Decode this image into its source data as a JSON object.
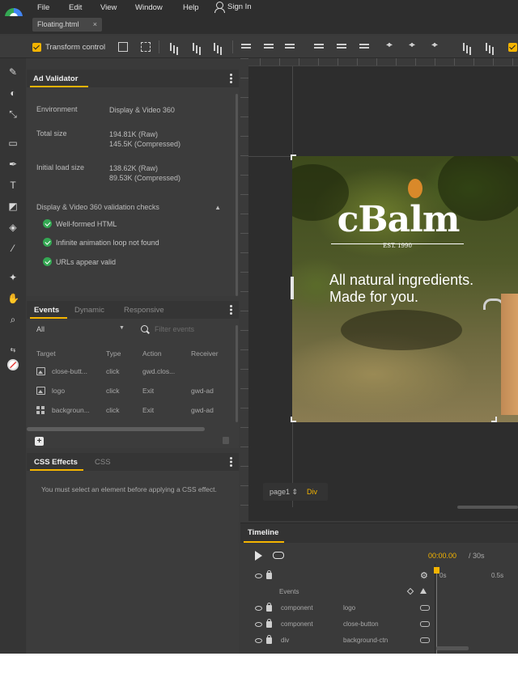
{
  "menu": {
    "file": "File",
    "edit": "Edit",
    "view": "View",
    "window": "Window",
    "help": "Help",
    "sign_in": "Sign In"
  },
  "document_tab": {
    "label": "Floating.html",
    "close": "×"
  },
  "toolbar": {
    "transform_control": "Transform control",
    "transform_checked": true
  },
  "validator": {
    "title": "Ad Validator",
    "environment_label": "Environment",
    "environment_value": "Display & Video 360",
    "total_size_label": "Total size",
    "total_size_raw": "194.81K (Raw)",
    "total_size_compressed": "145.5K (Compressed)",
    "initial_load_label": "Initial load size",
    "initial_load_raw": "138.62K (Raw)",
    "initial_load_compressed": "89.53K (Compressed)",
    "checks_title": "Display & Video 360 validation checks",
    "checks": [
      {
        "label": "Well-formed HTML",
        "status": "pass"
      },
      {
        "label": "Infinite animation loop not found",
        "status": "pass"
      },
      {
        "label": "URLs appear valid",
        "status": "pass"
      }
    ]
  },
  "events_panel": {
    "tabs": [
      "Events",
      "Dynamic",
      "Responsive"
    ],
    "active_tab": "Events",
    "filter_select": "All",
    "search_placeholder": "Filter events",
    "columns": [
      "Target",
      "Type",
      "Action",
      "Receiver"
    ],
    "rows": [
      {
        "icon": "image-icon",
        "target": "close-butt...",
        "type": "click",
        "action": "gwd.clos...",
        "receiver": ""
      },
      {
        "icon": "image-icon",
        "target": "logo",
        "type": "click",
        "action": "Exit",
        "receiver": "gwd-ad"
      },
      {
        "icon": "grid-icon",
        "target": "backgroun...",
        "type": "click",
        "action": "Exit",
        "receiver": "gwd-ad"
      }
    ]
  },
  "css_panel": {
    "tabs": [
      "CSS Effects",
      "CSS"
    ],
    "active_tab": "CSS Effects",
    "message": "You must select an element before applying a CSS effect."
  },
  "stage": {
    "page_label": "page1",
    "element_label": "Div",
    "ad": {
      "logo_text": "cBalm",
      "est_text": "EST. 1990",
      "tagline_line1": "All natural ingredients.",
      "tagline_line2": "Made for you."
    }
  },
  "timeline": {
    "title": "Timeline",
    "current_time": "00:00.00",
    "duration": "/ 30s",
    "tick_0": "0s",
    "tick_1": "0.5s",
    "events_row_label": "Events",
    "layers": [
      {
        "type": "component",
        "name": "logo"
      },
      {
        "type": "component",
        "name": "close-button"
      },
      {
        "type": "div",
        "name": "background-ctn"
      }
    ]
  },
  "colors": {
    "accent": "#f4b400",
    "pass": "#34a853",
    "panel_bg": "#3c3c3c",
    "app_bg": "#3a3a3a"
  }
}
